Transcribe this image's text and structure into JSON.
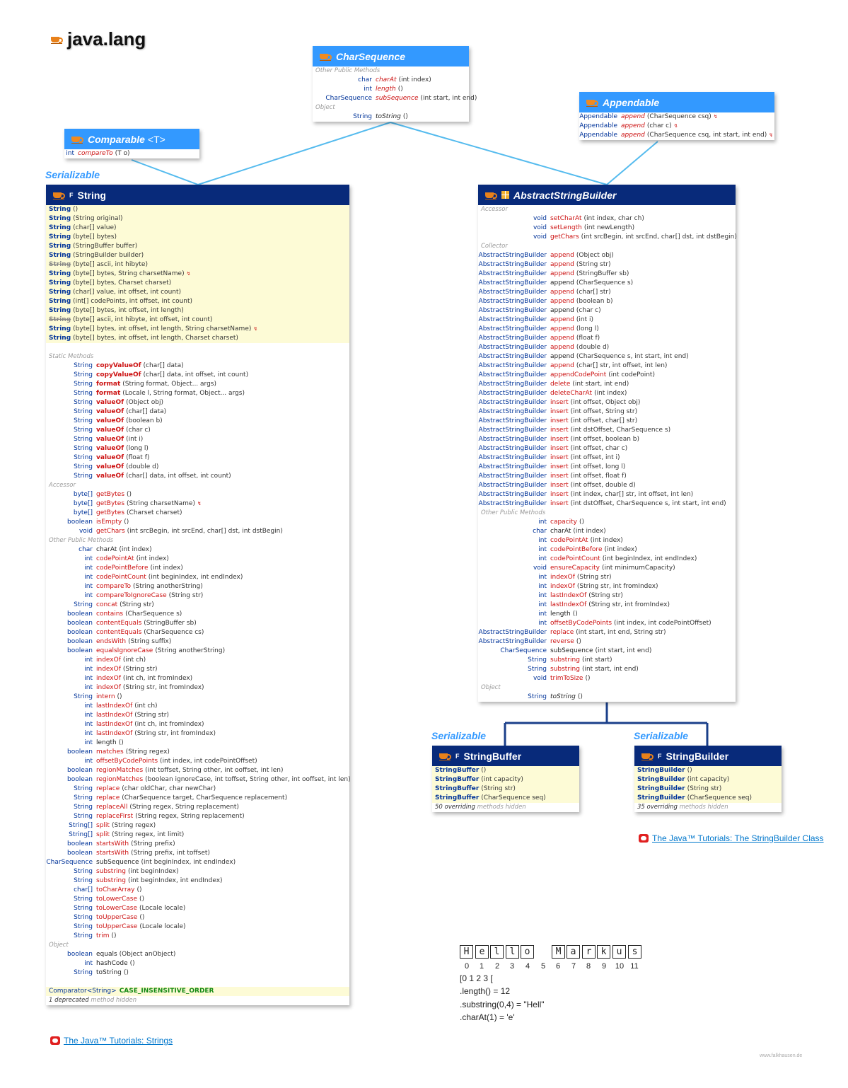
{
  "package_title": "java.lang",
  "colors": {
    "iface_header": "#3399ff",
    "class_header": "#082a7a",
    "method": "#cc1111",
    "type": "#003399",
    "link": "#0077cc",
    "highlight_row": "#fdfbd6"
  },
  "charsequence": {
    "name": "CharSequence",
    "rows": [
      {
        "s": "Other Public Methods"
      },
      {
        "r": "char",
        "n": "charAt",
        "p": "(int index)"
      },
      {
        "r": "int",
        "n": "length",
        "p": "()"
      },
      {
        "r": "CharSequence",
        "n": "subSequence",
        "p": "(int start, int end)"
      },
      {
        "s": "Object"
      },
      {
        "r": "String",
        "n": "toString",
        "p": "()",
        "k": true
      }
    ]
  },
  "appendable": {
    "name": "Appendable",
    "rows": [
      {
        "r": "Appendable",
        "n": "append",
        "p": "(CharSequence csq)",
        "x": true
      },
      {
        "r": "Appendable",
        "n": "append",
        "p": "(char c)",
        "x": true
      },
      {
        "r": "Appendable",
        "n": "append",
        "p": "(CharSequence csq, int start, int end)",
        "x": true
      }
    ]
  },
  "comparable": {
    "name": "Comparable",
    "generic": "<T>",
    "rows": [
      {
        "r": "int",
        "n": "compareTo",
        "p": "(T o)"
      }
    ]
  },
  "serializable_label": "Serializable",
  "string_box": {
    "name": "String",
    "final_mark": "F",
    "rows": [
      {
        "c": "String",
        "p": "()"
      },
      {
        "c": "String",
        "p": "(String original)"
      },
      {
        "c": "String",
        "p": "(char[] value)"
      },
      {
        "c": "String",
        "p": "(byte[] bytes)"
      },
      {
        "c": "String",
        "p": "(StringBuffer buffer)"
      },
      {
        "c": "String",
        "p": "(StringBuilder builder)"
      },
      {
        "c": "String",
        "p": "(byte[] ascii, int hibyte)",
        "d": true
      },
      {
        "c": "String",
        "p": "(byte[] bytes, String charsetName)",
        "x": true
      },
      {
        "c": "String",
        "p": "(byte[] bytes, Charset charset)"
      },
      {
        "c": "String",
        "p": "(char[] value, int offset, int count)"
      },
      {
        "c": "String",
        "p": "(int[] codePoints, int offset, int count)"
      },
      {
        "c": "String",
        "p": "(byte[] bytes, int offset, int length)"
      },
      {
        "c": "String",
        "p": "(byte[] ascii, int hibyte, int offset, int count)",
        "d": true
      },
      {
        "c": "String",
        "p": "(byte[] bytes, int offset, int length, String charsetName)",
        "x": true
      },
      {
        "c": "String",
        "p": "(byte[] bytes, int offset, int length, Charset charset)"
      },
      {
        "gap": true
      },
      {
        "s": "Static Methods"
      },
      {
        "r": "String",
        "n": "copyValueOf",
        "p": "(char[] data)",
        "b": true
      },
      {
        "r": "String",
        "n": "copyValueOf",
        "p": "(char[] data, int offset, int count)",
        "b": true
      },
      {
        "r": "String",
        "n": "format",
        "p": "(String format, Object... args)",
        "b": true
      },
      {
        "r": "String",
        "n": "format",
        "p": "(Locale l, String format, Object... args)",
        "b": true
      },
      {
        "r": "String",
        "n": "valueOf",
        "p": "(Object obj)",
        "b": true
      },
      {
        "r": "String",
        "n": "valueOf",
        "p": "(char[] data)",
        "b": true
      },
      {
        "r": "String",
        "n": "valueOf",
        "p": "(boolean b)",
        "b": true
      },
      {
        "r": "String",
        "n": "valueOf",
        "p": "(char c)",
        "b": true
      },
      {
        "r": "String",
        "n": "valueOf",
        "p": "(int i)",
        "b": true
      },
      {
        "r": "String",
        "n": "valueOf",
        "p": "(long l)",
        "b": true
      },
      {
        "r": "String",
        "n": "valueOf",
        "p": "(float f)",
        "b": true
      },
      {
        "r": "String",
        "n": "valueOf",
        "p": "(double d)",
        "b": true
      },
      {
        "r": "String",
        "n": "valueOf",
        "p": "(char[] data, int offset, int count)",
        "b": true
      },
      {
        "s": "Accessor"
      },
      {
        "r": "byte[]",
        "n": "getBytes",
        "p": "()"
      },
      {
        "r": "byte[]",
        "n": "getBytes",
        "p": "(String charsetName)",
        "x": true
      },
      {
        "r": "byte[]",
        "n": "getBytes",
        "p": "(Charset charset)"
      },
      {
        "r": "boolean",
        "n": "isEmpty",
        "p": "()"
      },
      {
        "r": "void",
        "n": "getChars",
        "p": "(int srcBegin, int srcEnd, char[] dst, int dstBegin)"
      },
      {
        "s": "Other Public Methods"
      },
      {
        "r": "char",
        "n": "charAt",
        "p": "(int index)",
        "k": true
      },
      {
        "r": "int",
        "n": "codePointAt",
        "p": "(int index)"
      },
      {
        "r": "int",
        "n": "codePointBefore",
        "p": "(int index)"
      },
      {
        "r": "int",
        "n": "codePointCount",
        "p": "(int beginIndex, int endIndex)"
      },
      {
        "r": "int",
        "n": "compareTo",
        "p": "(String anotherString)"
      },
      {
        "r": "int",
        "n": "compareToIgnoreCase",
        "p": "(String str)"
      },
      {
        "r": "String",
        "n": "concat",
        "p": "(String str)"
      },
      {
        "r": "boolean",
        "n": "contains",
        "p": "(CharSequence s)"
      },
      {
        "r": "boolean",
        "n": "contentEquals",
        "p": "(StringBuffer sb)"
      },
      {
        "r": "boolean",
        "n": "contentEquals",
        "p": "(CharSequence cs)"
      },
      {
        "r": "boolean",
        "n": "endsWith",
        "p": "(String suffix)"
      },
      {
        "r": "boolean",
        "n": "equalsIgnoreCase",
        "p": "(String anotherString)"
      },
      {
        "r": "int",
        "n": "indexOf",
        "p": "(int ch)"
      },
      {
        "r": "int",
        "n": "indexOf",
        "p": "(String str)"
      },
      {
        "r": "int",
        "n": "indexOf",
        "p": "(int ch, int fromIndex)"
      },
      {
        "r": "int",
        "n": "indexOf",
        "p": "(String str, int fromIndex)"
      },
      {
        "r": "String",
        "n": "intern",
        "p": "()"
      },
      {
        "r": "int",
        "n": "lastIndexOf",
        "p": "(int ch)"
      },
      {
        "r": "int",
        "n": "lastIndexOf",
        "p": "(String str)"
      },
      {
        "r": "int",
        "n": "lastIndexOf",
        "p": "(int ch, int fromIndex)"
      },
      {
        "r": "int",
        "n": "lastIndexOf",
        "p": "(String str, int fromIndex)"
      },
      {
        "r": "int",
        "n": "length",
        "p": "()",
        "k": true
      },
      {
        "r": "boolean",
        "n": "matches",
        "p": "(String regex)"
      },
      {
        "r": "int",
        "n": "offsetByCodePoints",
        "p": "(int index, int codePointOffset)"
      },
      {
        "r": "boolean",
        "n": "regionMatches",
        "p": "(int toffset, String other, int ooffset, int len)"
      },
      {
        "r": "boolean",
        "n": "regionMatches",
        "p": "(boolean ignoreCase, int toffset, String other, int ooffset, int len)"
      },
      {
        "r": "String",
        "n": "replace",
        "p": "(char oldChar, char newChar)"
      },
      {
        "r": "String",
        "n": "replace",
        "p": "(CharSequence target, CharSequence replacement)"
      },
      {
        "r": "String",
        "n": "replaceAll",
        "p": "(String regex, String replacement)"
      },
      {
        "r": "String",
        "n": "replaceFirst",
        "p": "(String regex, String replacement)"
      },
      {
        "r": "String[]",
        "n": "split",
        "p": "(String regex)"
      },
      {
        "r": "String[]",
        "n": "split",
        "p": "(String regex, int limit)"
      },
      {
        "r": "boolean",
        "n": "startsWith",
        "p": "(String prefix)"
      },
      {
        "r": "boolean",
        "n": "startsWith",
        "p": "(String prefix, int toffset)"
      },
      {
        "r": "CharSequence",
        "n": "subSequence",
        "p": "(int beginIndex, int endIndex)",
        "k": true
      },
      {
        "r": "String",
        "n": "substring",
        "p": "(int beginIndex)"
      },
      {
        "r": "String",
        "n": "substring",
        "p": "(int beginIndex, int endIndex)"
      },
      {
        "r": "char[]",
        "n": "toCharArray",
        "p": "()"
      },
      {
        "r": "String",
        "n": "toLowerCase",
        "p": "()"
      },
      {
        "r": "String",
        "n": "toLowerCase",
        "p": "(Locale locale)"
      },
      {
        "r": "String",
        "n": "toUpperCase",
        "p": "()"
      },
      {
        "r": "String",
        "n": "toUpperCase",
        "p": "(Locale locale)"
      },
      {
        "r": "String",
        "n": "trim",
        "p": "()"
      },
      {
        "s": "Object"
      },
      {
        "r": "boolean",
        "n": "equals",
        "p": "(Object anObject)",
        "k": true
      },
      {
        "r": "int",
        "n": "hashCode",
        "p": "()",
        "k": true
      },
      {
        "r": "String",
        "n": "toString",
        "p": "()",
        "k": true
      },
      {
        "gap": true
      }
    ],
    "field": {
      "type": "Comparator<String>",
      "name": "CASE_INSENSITIVE_ORDER"
    },
    "footer": {
      "count": "1 deprecated",
      "text": "method hidden"
    }
  },
  "asb_box": {
    "name": "AbstractStringBuilder",
    "rows": [
      {
        "s": "Accessor"
      },
      {
        "r": "void",
        "n": "setCharAt",
        "p": "(int index, char ch)"
      },
      {
        "r": "void",
        "n": "setLength",
        "p": "(int newLength)"
      },
      {
        "r": "void",
        "n": "getChars",
        "p": "(int srcBegin, int srcEnd, char[] dst, int dstBegin)"
      },
      {
        "s": "Collector"
      },
      {
        "r": "AbstractStringBuilder",
        "n": "append",
        "p": "(Object obj)"
      },
      {
        "r": "AbstractStringBuilder",
        "n": "append",
        "p": "(String str)"
      },
      {
        "r": "AbstractStringBuilder",
        "n": "append",
        "p": "(StringBuffer sb)"
      },
      {
        "r": "AbstractStringBuilder",
        "n": "append",
        "p": "(CharSequence s)",
        "k": true
      },
      {
        "r": "AbstractStringBuilder",
        "n": "append",
        "p": "(char[] str)"
      },
      {
        "r": "AbstractStringBuilder",
        "n": "append",
        "p": "(boolean b)"
      },
      {
        "r": "AbstractStringBuilder",
        "n": "append",
        "p": "(char c)",
        "k": true
      },
      {
        "r": "AbstractStringBuilder",
        "n": "append",
        "p": "(int i)"
      },
      {
        "r": "AbstractStringBuilder",
        "n": "append",
        "p": "(long l)"
      },
      {
        "r": "AbstractStringBuilder",
        "n": "append",
        "p": "(float f)"
      },
      {
        "r": "AbstractStringBuilder",
        "n": "append",
        "p": "(double d)"
      },
      {
        "r": "AbstractStringBuilder",
        "n": "append",
        "p": "(CharSequence s, int start, int end)",
        "k": true
      },
      {
        "r": "AbstractStringBuilder",
        "n": "append",
        "p": "(char[] str, int offset, int len)"
      },
      {
        "r": "AbstractStringBuilder",
        "n": "appendCodePoint",
        "p": "(int codePoint)"
      },
      {
        "r": "AbstractStringBuilder",
        "n": "delete",
        "p": "(int start, int end)"
      },
      {
        "r": "AbstractStringBuilder",
        "n": "deleteCharAt",
        "p": "(int index)"
      },
      {
        "r": "AbstractStringBuilder",
        "n": "insert",
        "p": "(int offset, Object obj)"
      },
      {
        "r": "AbstractStringBuilder",
        "n": "insert",
        "p": "(int offset, String str)"
      },
      {
        "r": "AbstractStringBuilder",
        "n": "insert",
        "p": "(int offset, char[] str)"
      },
      {
        "r": "AbstractStringBuilder",
        "n": "insert",
        "p": "(int dstOffset, CharSequence s)"
      },
      {
        "r": "AbstractStringBuilder",
        "n": "insert",
        "p": "(int offset, boolean b)"
      },
      {
        "r": "AbstractStringBuilder",
        "n": "insert",
        "p": "(int offset, char c)"
      },
      {
        "r": "AbstractStringBuilder",
        "n": "insert",
        "p": "(int offset, int i)"
      },
      {
        "r": "AbstractStringBuilder",
        "n": "insert",
        "p": "(int offset, long l)"
      },
      {
        "r": "AbstractStringBuilder",
        "n": "insert",
        "p": "(int offset, float f)"
      },
      {
        "r": "AbstractStringBuilder",
        "n": "insert",
        "p": "(int offset, double d)"
      },
      {
        "r": "AbstractStringBuilder",
        "n": "insert",
        "p": "(int index, char[] str, int offset, int len)"
      },
      {
        "r": "AbstractStringBuilder",
        "n": "insert",
        "p": "(int dstOffset, CharSequence s, int start, int end)"
      },
      {
        "s": "Other Public Methods"
      },
      {
        "r": "int",
        "n": "capacity",
        "p": "()"
      },
      {
        "r": "char",
        "n": "charAt",
        "p": "(int index)",
        "k": true
      },
      {
        "r": "int",
        "n": "codePointAt",
        "p": "(int index)"
      },
      {
        "r": "int",
        "n": "codePointBefore",
        "p": "(int index)"
      },
      {
        "r": "int",
        "n": "codePointCount",
        "p": "(int beginIndex, int endIndex)"
      },
      {
        "r": "void",
        "n": "ensureCapacity",
        "p": "(int minimumCapacity)"
      },
      {
        "r": "int",
        "n": "indexOf",
        "p": "(String str)"
      },
      {
        "r": "int",
        "n": "indexOf",
        "p": "(String str, int fromIndex)"
      },
      {
        "r": "int",
        "n": "lastIndexOf",
        "p": "(String str)"
      },
      {
        "r": "int",
        "n": "lastIndexOf",
        "p": "(String str, int fromIndex)"
      },
      {
        "r": "int",
        "n": "length",
        "p": "()",
        "k": true
      },
      {
        "r": "int",
        "n": "offsetByCodePoints",
        "p": "(int index, int codePointOffset)"
      },
      {
        "r": "AbstractStringBuilder",
        "n": "replace",
        "p": "(int start, int end, String str)"
      },
      {
        "r": "AbstractStringBuilder",
        "n": "reverse",
        "p": "()"
      },
      {
        "r": "CharSequence",
        "n": "subSequence",
        "p": "(int start, int end)",
        "k": true
      },
      {
        "r": "String",
        "n": "substring",
        "p": "(int start)"
      },
      {
        "r": "String",
        "n": "substring",
        "p": "(int start, int end)"
      },
      {
        "r": "void",
        "n": "trimToSize",
        "p": "()"
      },
      {
        "s": "Object"
      },
      {
        "r": "String",
        "n": "toString",
        "p": "()",
        "k": true,
        "i": true
      }
    ]
  },
  "stringbuffer_box": {
    "name": "StringBuffer",
    "final_mark": "F",
    "rows": [
      {
        "c": "StringBuffer",
        "p": "()"
      },
      {
        "c": "StringBuffer",
        "p": "(int capacity)"
      },
      {
        "c": "StringBuffer",
        "p": "(String str)"
      },
      {
        "c": "StringBuffer",
        "p": "(CharSequence seq)"
      }
    ],
    "footer": {
      "count": "50 overriding",
      "text": "methods hidden"
    }
  },
  "stringbuilder_box": {
    "name": "StringBuilder",
    "final_mark": "F",
    "rows": [
      {
        "c": "StringBuilder",
        "p": "()"
      },
      {
        "c": "StringBuilder",
        "p": "(int capacity)"
      },
      {
        "c": "StringBuilder",
        "p": "(String str)"
      },
      {
        "c": "StringBuilder",
        "p": "(CharSequence seq)"
      }
    ],
    "footer": {
      "count": "35 overriding",
      "text": "methods hidden"
    }
  },
  "tutorials": {
    "stringbuilder": "The Java™ Tutorials: The StringBuilder Class",
    "strings": "The Java™ Tutorials: Strings"
  },
  "hello": {
    "chars": [
      "H",
      "e",
      "l",
      "l",
      "o",
      " ",
      "M",
      "a",
      "r",
      "k",
      "u",
      "s"
    ],
    "indices": [
      "0",
      "1",
      "2",
      "3",
      "4",
      "5",
      "6",
      "7",
      "8",
      "9",
      "10",
      "11"
    ],
    "bracket_line": "[0    1    2    3    [",
    "lines": [
      ".length() = 12",
      ".substring(0,4) = \"Hell\"",
      ".charAt(1) = 'e'"
    ]
  },
  "watermark": "www.falkhausen.de"
}
